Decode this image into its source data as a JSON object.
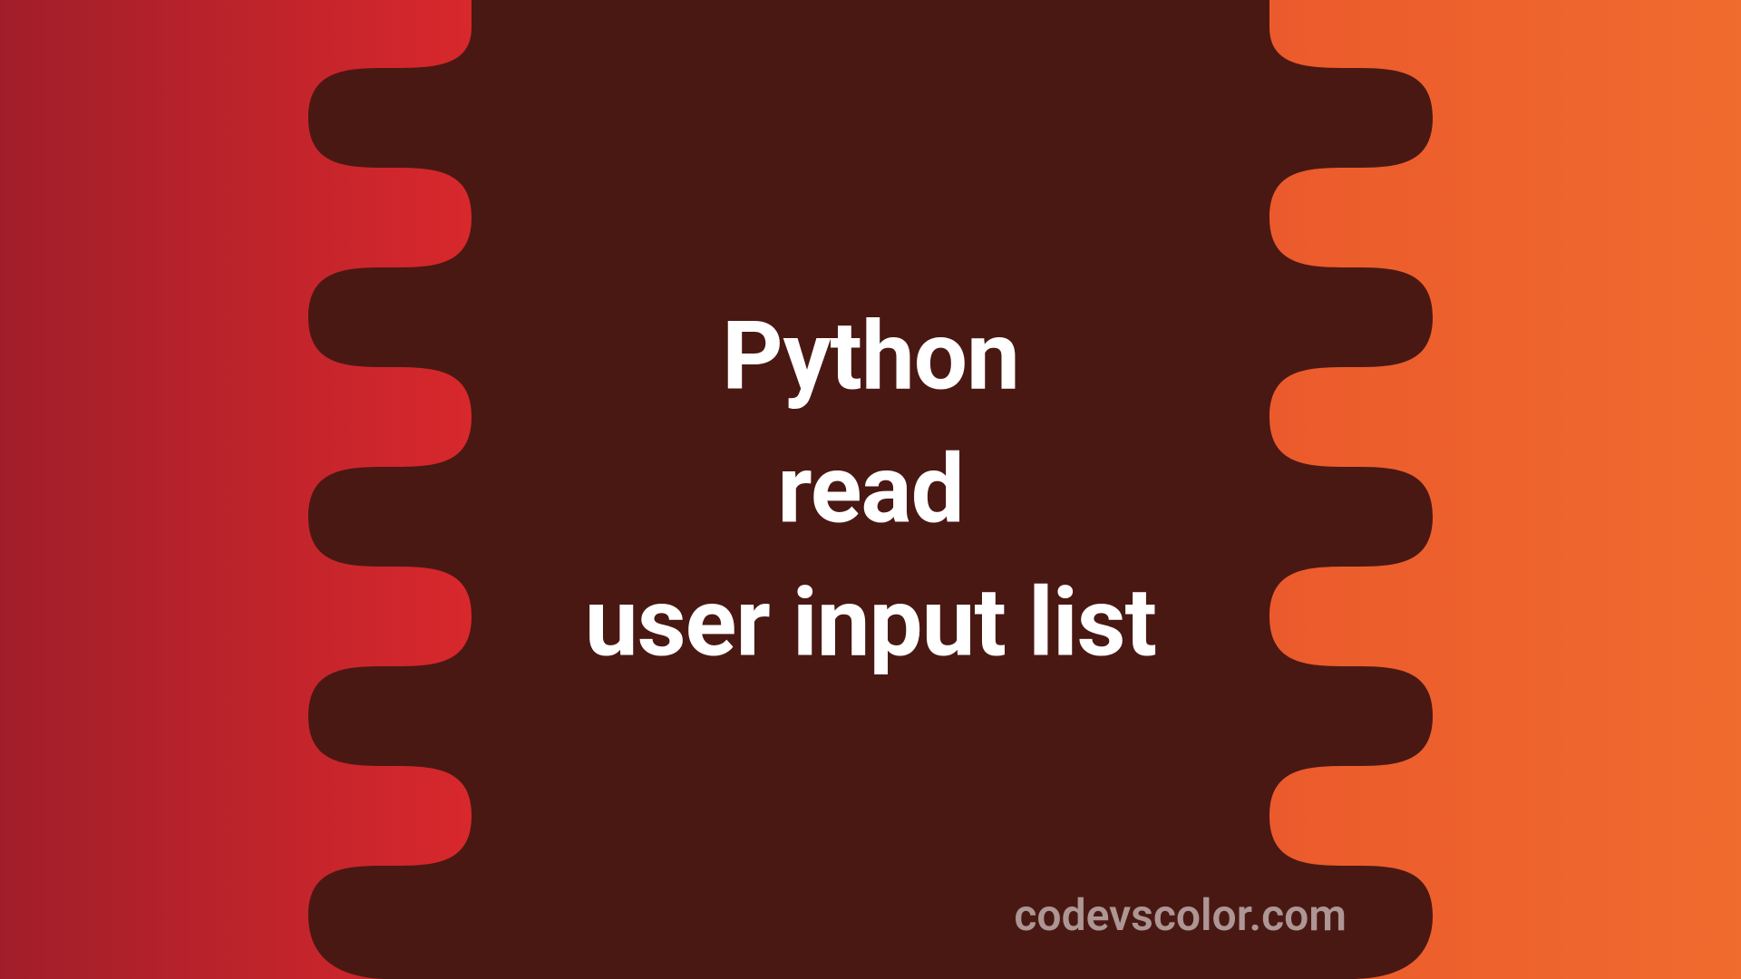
{
  "title": {
    "line1": "Python",
    "line2": "read",
    "line3": "user input list"
  },
  "watermark": "codevscolor.com",
  "colors": {
    "background_dark": "#4a1813",
    "left_gradient_start": "#a01e2a",
    "left_gradient_end": "#d8282c",
    "right_gradient_start": "#eb5a2c",
    "right_gradient_end": "#f06b2e",
    "text_primary": "#ffffff",
    "text_secondary": "rgba(255,255,255,0.55)"
  }
}
